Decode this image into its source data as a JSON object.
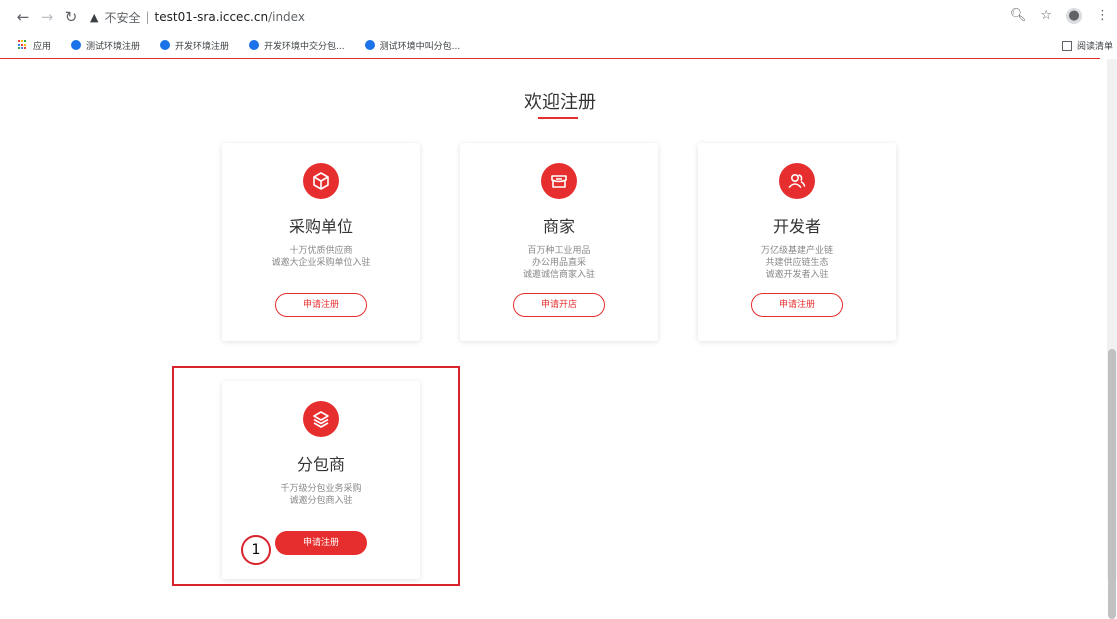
{
  "browser": {
    "insecure_label": "不安全",
    "separator": "|",
    "url_host": "test01-sra.iccec.cn",
    "url_path": "/index",
    "bookmarks": [
      {
        "label": "应用"
      },
      {
        "label": "测试环境注册"
      },
      {
        "label": "开发环境注册"
      },
      {
        "label": "开发环境中交分包..."
      },
      {
        "label": "测试环境中叫分包..."
      }
    ],
    "reading_list_label": "阅读清单"
  },
  "page": {
    "title": "欢迎注册",
    "accent_color": "#e62e2e",
    "cards": [
      {
        "name": "采购单位",
        "icon": "package-icon",
        "desc": [
          "十万优质供应商",
          "诚邀大企业采购单位入驻"
        ],
        "button": "申请注册"
      },
      {
        "name": "商家",
        "icon": "store-icon",
        "desc": [
          "百万种工业用品",
          "办公用品直采",
          "诚邀诚信商家入驻"
        ],
        "button": "申请开店"
      },
      {
        "name": "开发者",
        "icon": "users-icon",
        "desc": [
          "万亿级基建产业链",
          "共建供应链生态",
          "诚邀开发者入驻"
        ],
        "button": "申请注册"
      },
      {
        "name": "分包商",
        "icon": "layers-icon",
        "desc": [
          "千万级分包业务采购",
          "诚邀分包商入驻"
        ],
        "button": "申请注册"
      }
    ]
  },
  "annotation": {
    "marker_label": "1"
  }
}
